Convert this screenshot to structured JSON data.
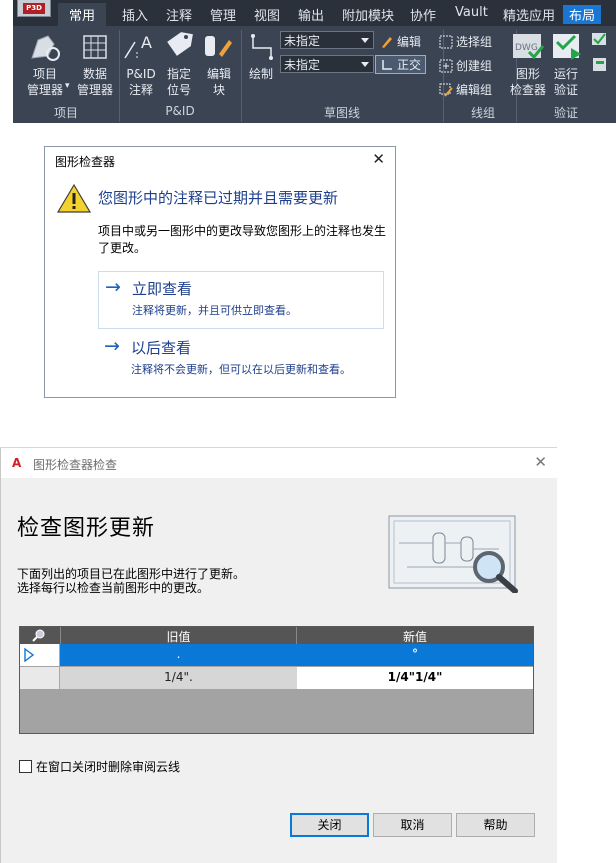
{
  "ribbon": {
    "app_logo": "P3D",
    "tabs": [
      "常用",
      "插入",
      "注释",
      "管理",
      "视图",
      "输出",
      "附加模块",
      "协作",
      "Vault",
      "精选应用",
      "布局"
    ],
    "active_tab": "常用",
    "groups": {
      "project": {
        "label": "项目",
        "project_manager": [
          "项目",
          "管理器"
        ],
        "data_manager": [
          "数据",
          "管理器"
        ]
      },
      "pid": {
        "label": "P&ID",
        "pid_annotation": [
          "P&ID",
          "注释"
        ],
        "assign_tag": [
          "指定",
          "位号"
        ],
        "edit_block": [
          "编辑",
          "块"
        ]
      },
      "sketch": {
        "label": "草图线",
        "draw": "绘制",
        "combo1": "未指定",
        "combo2": "未指定",
        "edit": "编辑",
        "ortho": "正交"
      },
      "linegroup": {
        "label": "线组",
        "select_group": "选择组",
        "create_group": "创建组",
        "edit_group": "编辑组"
      },
      "validate": {
        "label": "验证",
        "drawing_checker": [
          "图形",
          "检查器"
        ],
        "run_validate": [
          "运行",
          "验证"
        ]
      }
    }
  },
  "notice": {
    "title": "图形检查器",
    "close": "✕",
    "heading": "您图形中的注释已过期并且需要更新",
    "description": "项目中或另一图形中的更改导致您图形上的注释也发生了更改。",
    "options": [
      {
        "title": "立即查看",
        "subtitle": "注释将更新，并且可供立即查看。"
      },
      {
        "title": "以后查看",
        "subtitle": "注释将不会更新，但可以在以后更新和查看。"
      }
    ]
  },
  "check": {
    "title": "图形检查器检查",
    "close": "✕",
    "heading": "检查图形更新",
    "desc1": "下面列出的项目已在此图形中进行了更新。",
    "desc2": "选择每行以检查当前图形中的更改。",
    "grid": {
      "columns": [
        "旧值",
        "新值"
      ],
      "rows": [
        {
          "old": ".",
          "new": "°"
        },
        {
          "old": "1/4\".",
          "new": "1/4\"1/4\""
        }
      ]
    },
    "checkbox_label": "在窗口关闭时删除审阅云线",
    "buttons": {
      "close": "关闭",
      "cancel": "取消",
      "help": "帮助"
    }
  }
}
